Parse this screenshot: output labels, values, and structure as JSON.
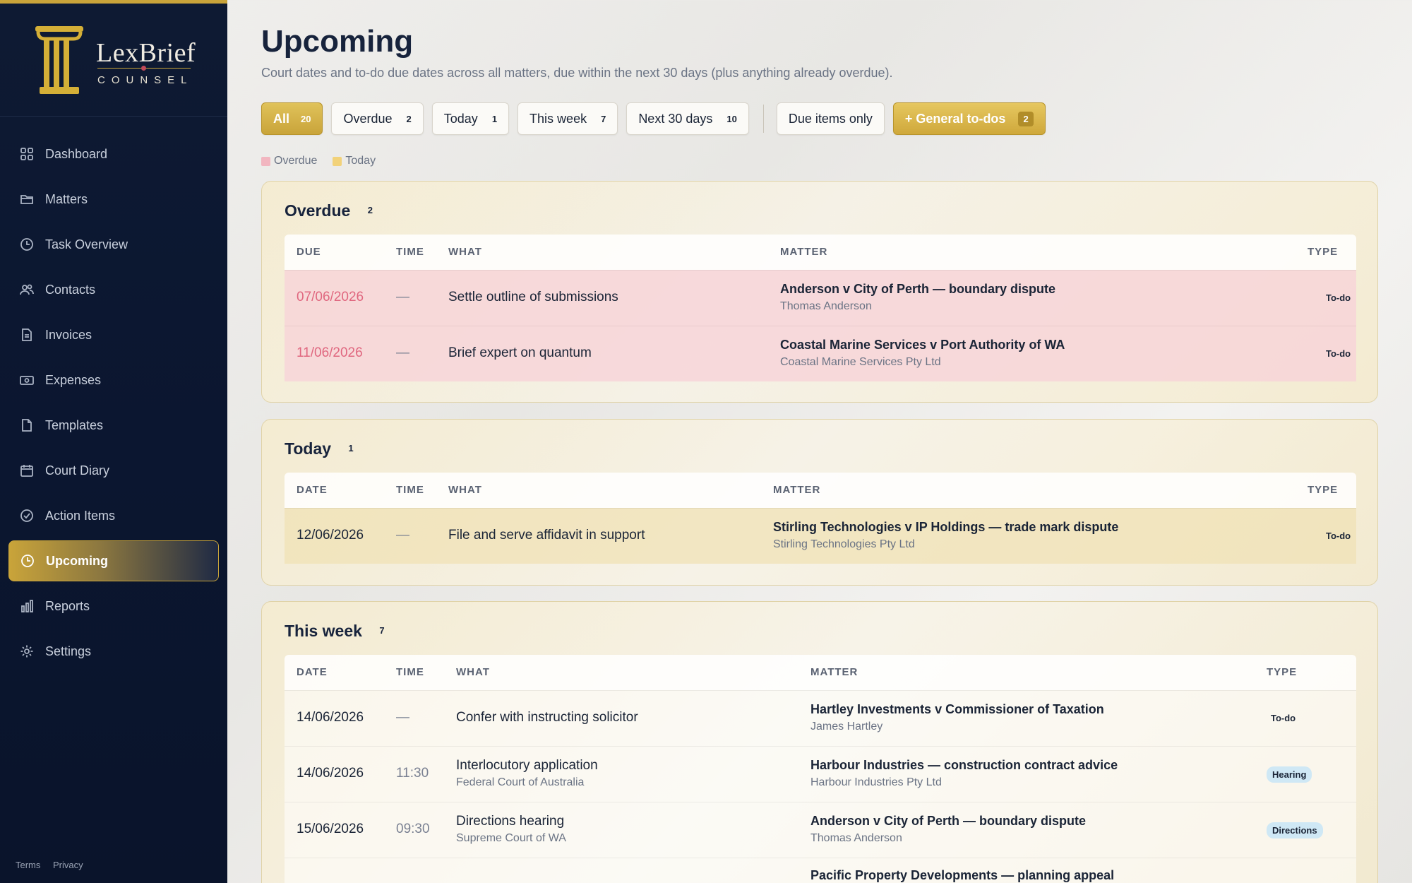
{
  "brand": {
    "name": "LexBrief",
    "sub": "COUNSEL"
  },
  "nav": [
    {
      "label": "Dashboard",
      "icon": "grid-icon"
    },
    {
      "label": "Matters",
      "icon": "folder-icon"
    },
    {
      "label": "Task Overview",
      "icon": "clock-icon"
    },
    {
      "label": "Contacts",
      "icon": "users-icon"
    },
    {
      "label": "Invoices",
      "icon": "invoice-icon"
    },
    {
      "label": "Expenses",
      "icon": "cash-icon"
    },
    {
      "label": "Templates",
      "icon": "file-icon"
    },
    {
      "label": "Court Diary",
      "icon": "calendar-icon"
    },
    {
      "label": "Action Items",
      "icon": "check-circle-icon"
    },
    {
      "label": "Upcoming",
      "icon": "clock-icon",
      "active": true
    },
    {
      "label": "Reports",
      "icon": "bar-chart-icon"
    },
    {
      "label": "Settings",
      "icon": "gear-icon"
    }
  ],
  "footer": {
    "terms": "Terms",
    "privacy": "Privacy"
  },
  "page": {
    "title": "Upcoming",
    "subtitle": "Court dates and to-do due dates across all matters, due within the next 30 days (plus anything already overdue)."
  },
  "filters": {
    "all": {
      "label": "All",
      "count": "20"
    },
    "overdue": {
      "label": "Overdue",
      "count": "2"
    },
    "today": {
      "label": "Today",
      "count": "1"
    },
    "week": {
      "label": "This week",
      "count": "7"
    },
    "next30": {
      "label": "Next 30 days",
      "count": "10"
    },
    "due_only": {
      "label": "Due items only"
    },
    "general": {
      "label": "+ General to-dos",
      "count": "2"
    }
  },
  "legend": {
    "overdue": "Overdue",
    "today": "Today",
    "overdue_color": "#f2b6c0",
    "today_color": "#f2d27a"
  },
  "sections": {
    "overdue": {
      "title": "Overdue",
      "count": "2",
      "headers": {
        "due": "DUE",
        "time": "TIME",
        "what": "WHAT",
        "matter": "MATTER",
        "type": "TYPE"
      },
      "rows": [
        {
          "date": "07/06/2026",
          "time": "—",
          "what": "Settle outline of submissions",
          "matter": "Anderson v City of Perth — boundary dispute",
          "client": "Thomas Anderson",
          "type": "To-do"
        },
        {
          "date": "11/06/2026",
          "time": "—",
          "what": "Brief expert on quantum",
          "matter": "Coastal Marine Services v Port Authority of WA",
          "client": "Coastal Marine Services Pty Ltd",
          "type": "To-do"
        }
      ]
    },
    "today": {
      "title": "Today",
      "count": "1",
      "headers": {
        "date": "DATE",
        "time": "TIME",
        "what": "WHAT",
        "matter": "MATTER",
        "type": "TYPE"
      },
      "rows": [
        {
          "date": "12/06/2026",
          "time": "—",
          "what": "File and serve affidavit in support",
          "matter": "Stirling Technologies v IP Holdings — trade mark dispute",
          "client": "Stirling Technologies Pty Ltd",
          "type": "To-do"
        }
      ]
    },
    "week": {
      "title": "This week",
      "count": "7",
      "headers": {
        "date": "DATE",
        "time": "TIME",
        "what": "WHAT",
        "matter": "MATTER",
        "type": "TYPE"
      },
      "rows": [
        {
          "date": "14/06/2026",
          "time": "—",
          "what": "Confer with instructing solicitor",
          "what_sub": "",
          "matter": "Hartley Investments v Commissioner of Taxation",
          "client": "James Hartley",
          "type": "To-do"
        },
        {
          "date": "14/06/2026",
          "time": "11:30",
          "what": "Interlocutory application",
          "what_sub": "Federal Court of Australia",
          "matter": "Harbour Industries — construction contract advice",
          "client": "Harbour Industries Pty Ltd",
          "type": "Hearing"
        },
        {
          "date": "15/06/2026",
          "time": "09:30",
          "what": "Directions hearing",
          "what_sub": "Supreme Court of WA",
          "matter": "Anderson v City of Perth — boundary dispute",
          "client": "Thomas Anderson",
          "type": "Directions"
        },
        {
          "matter": "Pacific Property Developments — planning appeal"
        }
      ]
    }
  }
}
